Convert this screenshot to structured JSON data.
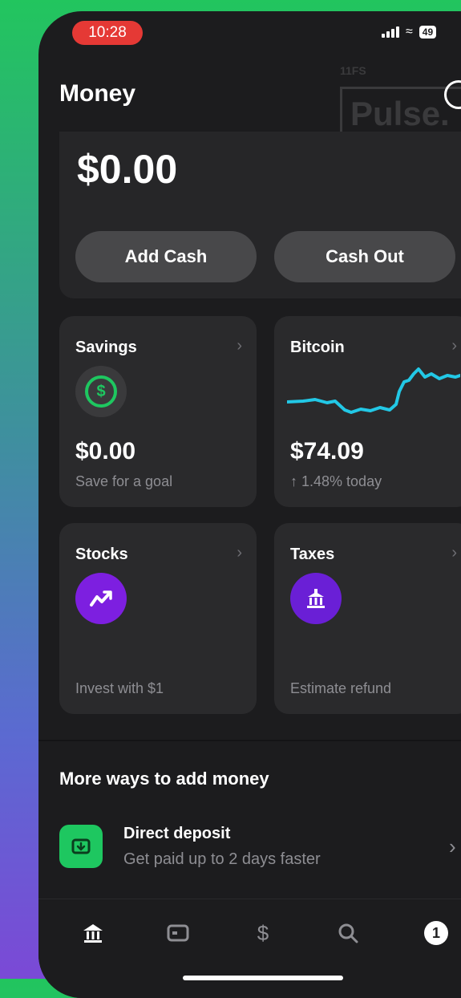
{
  "status": {
    "time": "10:28",
    "battery": "49"
  },
  "header": {
    "title": "Money",
    "watermark_tag": "11FS",
    "watermark": "Pulse."
  },
  "balance": {
    "amount": "$0.00",
    "add_cash": "Add Cash",
    "cash_out": "Cash Out"
  },
  "tiles": {
    "savings": {
      "title": "Savings",
      "value": "$0.00",
      "sub": "Save for a goal"
    },
    "bitcoin": {
      "title": "Bitcoin",
      "value": "$74.09",
      "sub": "↑ 1.48% today"
    },
    "stocks": {
      "title": "Stocks",
      "sub": "Invest with $1"
    },
    "taxes": {
      "title": "Taxes",
      "sub": "Estimate refund"
    }
  },
  "more": {
    "title": "More ways to add money",
    "direct_deposit": {
      "title": "Direct deposit",
      "sub": "Get paid up to 2 days faster"
    }
  },
  "tabbar": {
    "badge": "1"
  },
  "colors": {
    "green": "#1ec760",
    "purple": "#7d1fe0",
    "bitcoin_line": "#22c8e6"
  }
}
